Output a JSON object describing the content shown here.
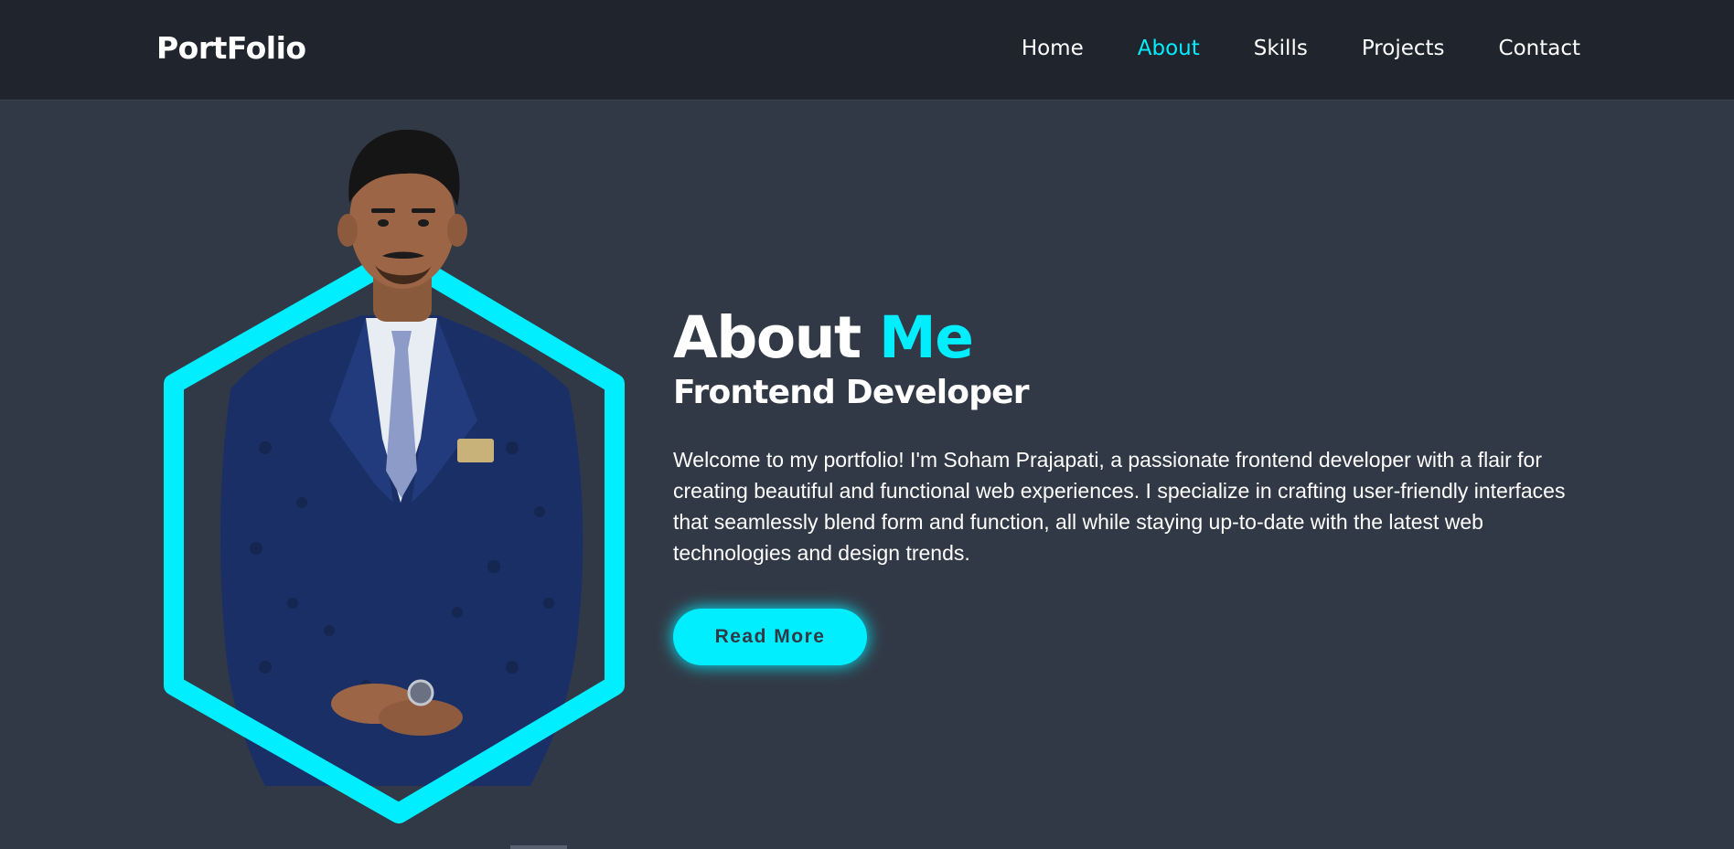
{
  "header": {
    "logo": "PortFolio",
    "nav": [
      {
        "label": "Home",
        "active": false
      },
      {
        "label": "About",
        "active": true
      },
      {
        "label": "Skills",
        "active": false
      },
      {
        "label": "Projects",
        "active": false
      },
      {
        "label": "Contact",
        "active": false
      }
    ]
  },
  "about": {
    "heading_main": "About",
    "heading_accent": "Me",
    "subheading": "Frontend Developer",
    "bio": "Welcome to my portfolio! I'm Soham Prajapati, a passionate frontend developer with a flair for creating beautiful and functional web experiences. I specialize in crafting user-friendly interfaces that seamlessly blend form and function, all while staying up-to-date with the latest web technologies and design trends.",
    "button_label": "Read More"
  },
  "colors": {
    "accent": "#00eeff",
    "background": "#323946",
    "header_background": "#1f242d"
  },
  "icons": {
    "profile_image": "portrait-photo"
  }
}
